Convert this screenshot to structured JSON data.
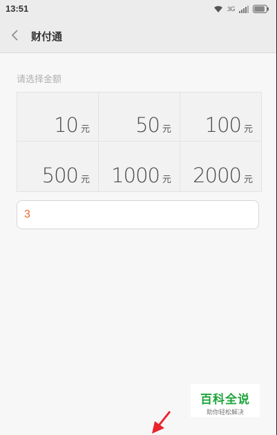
{
  "status_bar": {
    "time": "13:51",
    "network_text": "3G",
    "icons": [
      "wifi-icon",
      "signal-icon",
      "battery-icon"
    ]
  },
  "title_bar": {
    "title": "财付通",
    "back_icon": "chevron-left-icon"
  },
  "amount_section": {
    "label": "请选择金额",
    "unit": "元",
    "options": [
      {
        "value": "10",
        "unit": "元"
      },
      {
        "value": "50",
        "unit": "元"
      },
      {
        "value": "100",
        "unit": "元"
      },
      {
        "value": "500",
        "unit": "元"
      },
      {
        "value": "1000",
        "unit": "元"
      },
      {
        "value": "2000",
        "unit": "元"
      }
    ]
  },
  "custom_amount": {
    "value": "3"
  },
  "watermark": {
    "title": "百科全说",
    "subtitle": "助你轻松解决"
  },
  "colors": {
    "background": "#f7f7f7",
    "input_text": "#e0682a",
    "watermark_green": "#1da53a",
    "arrow_red": "#e8242b"
  }
}
